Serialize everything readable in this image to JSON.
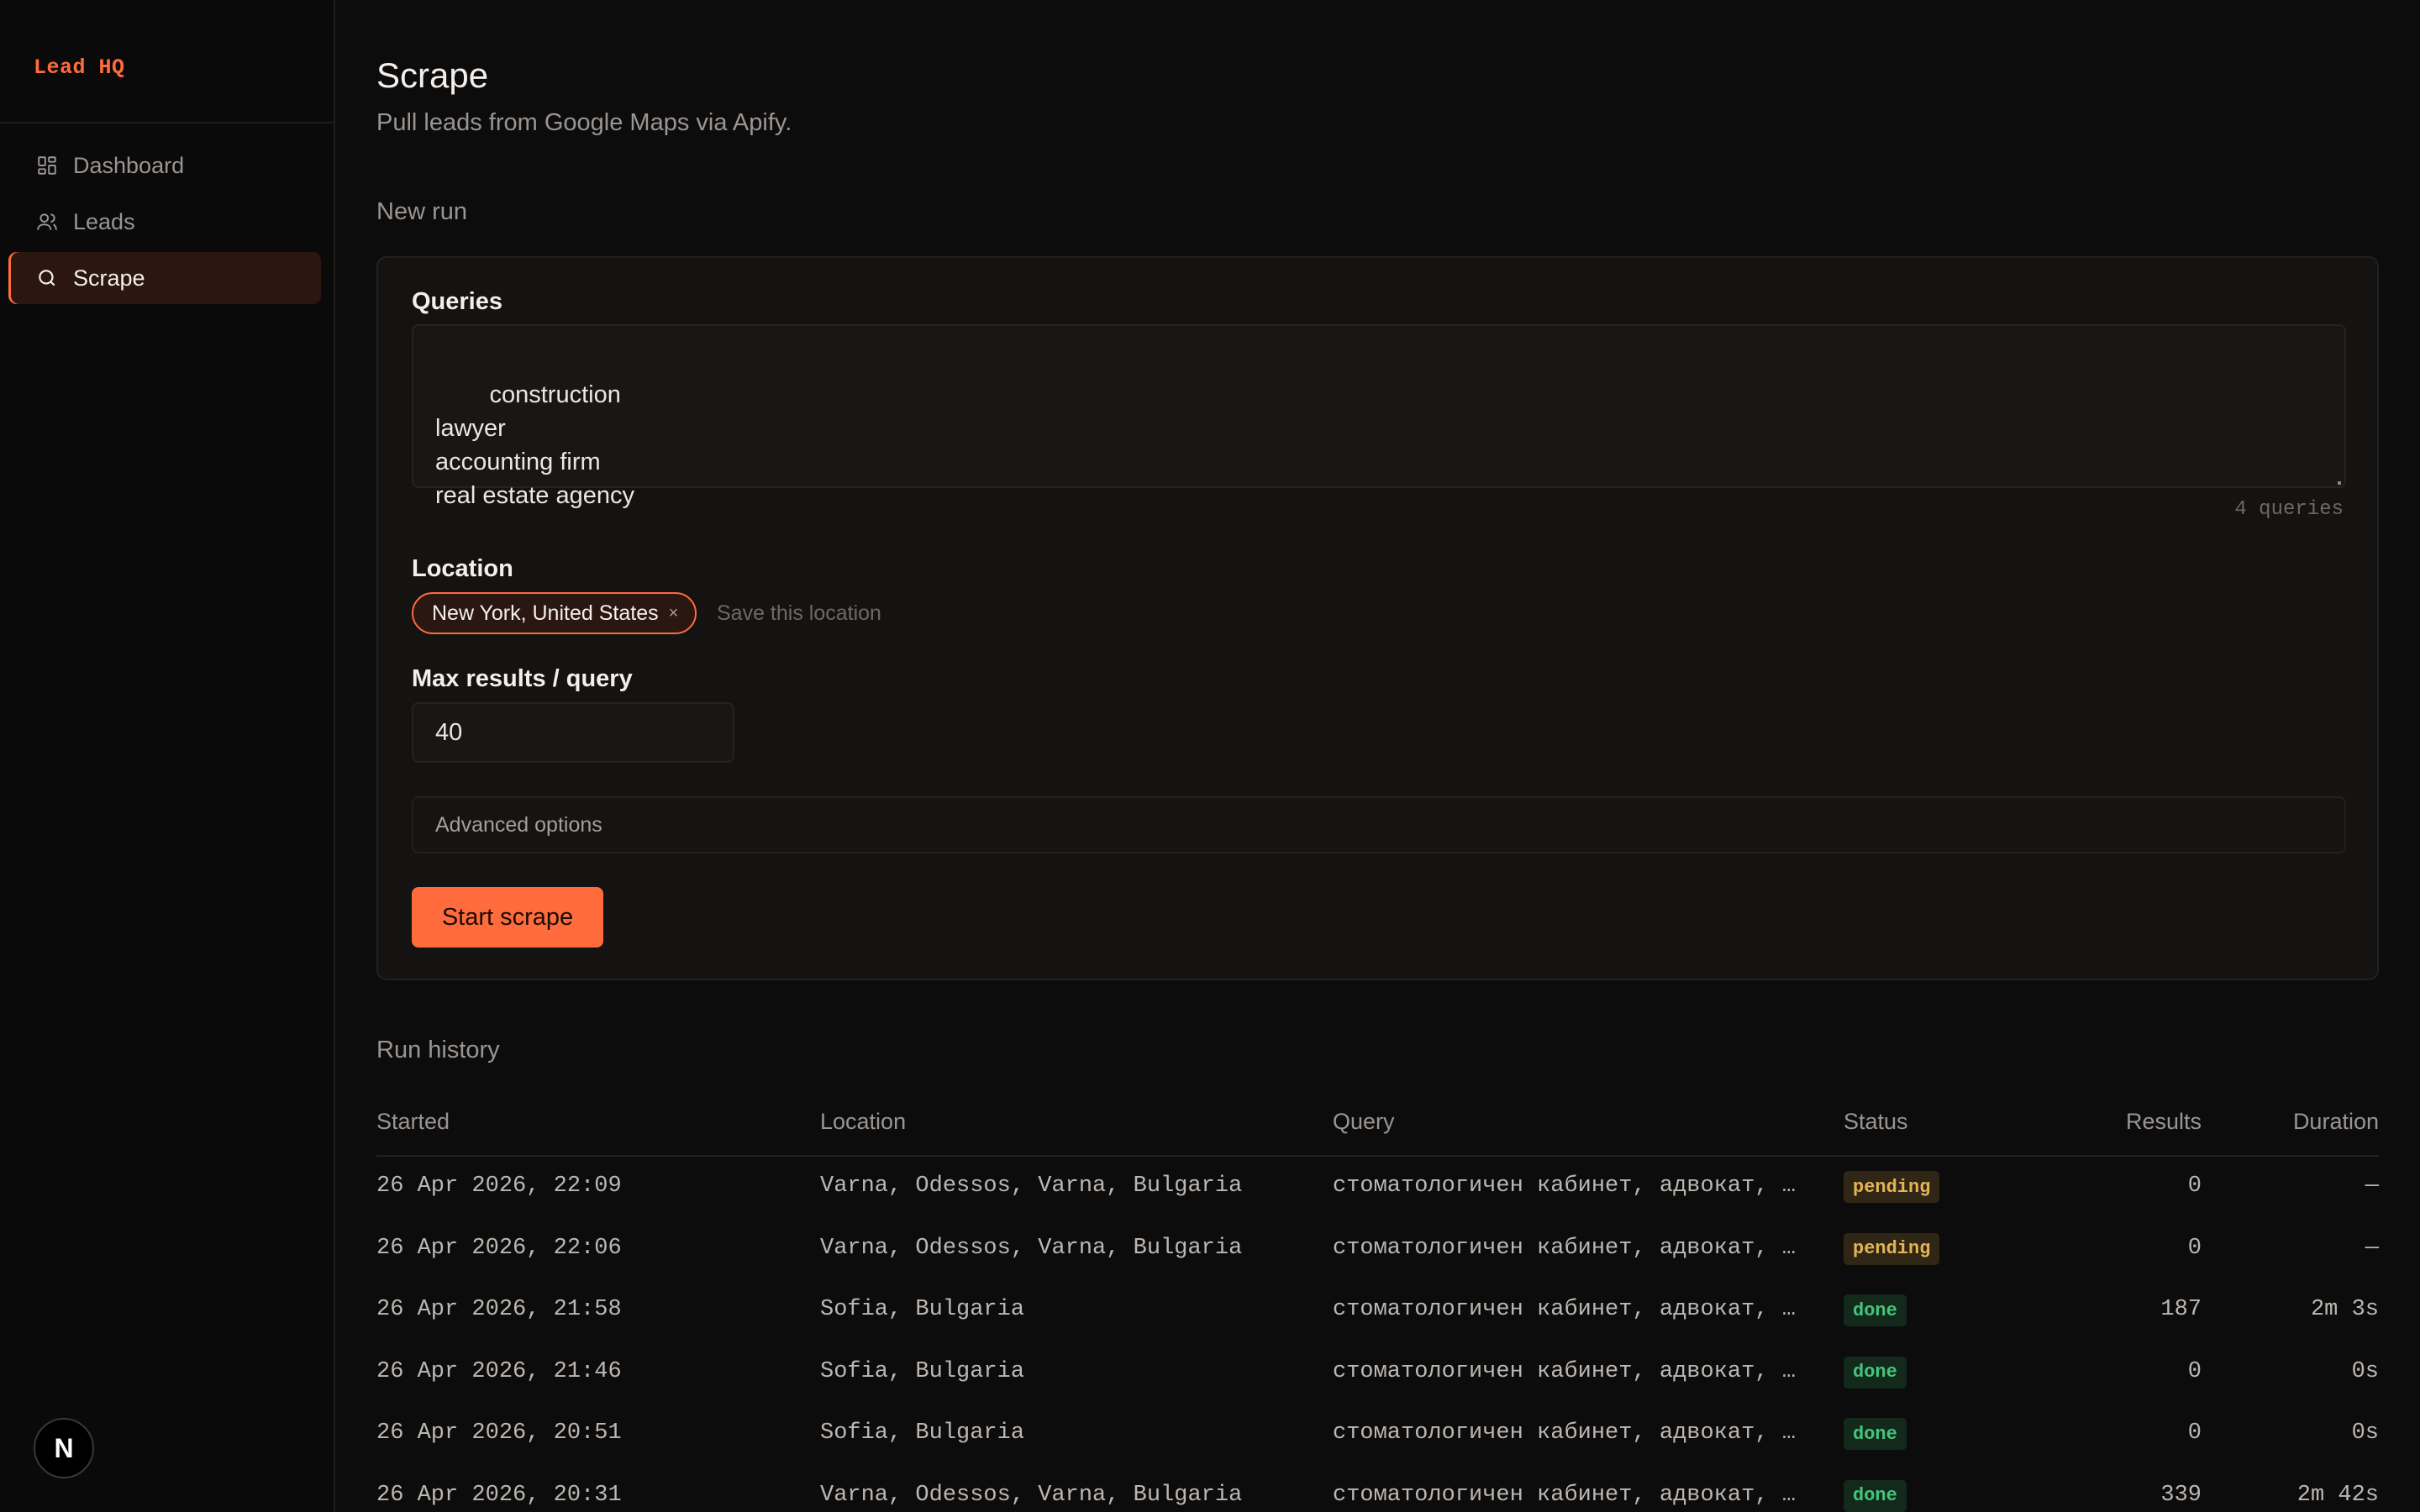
{
  "app": {
    "brand": "Lead HQ"
  },
  "sidebar": {
    "items": [
      {
        "label": "Dashboard",
        "icon": "dashboard-icon",
        "active": false
      },
      {
        "label": "Leads",
        "icon": "users-icon",
        "active": false
      },
      {
        "label": "Scrape",
        "icon": "search-icon",
        "active": true
      }
    ],
    "badge": "N"
  },
  "page": {
    "title": "Scrape",
    "subtitle": "Pull leads from Google Maps via Apify."
  },
  "new_run": {
    "section_label": "New run",
    "queries_label": "Queries",
    "queries_value": "construction\nlawyer\naccounting firm\nreal estate agency",
    "query_count": "4 queries",
    "location_label": "Location",
    "location_chip": "New York, United States",
    "chip_remove": "×",
    "save_location": "Save this location",
    "max_results_label": "Max results / query",
    "max_results_value": "40",
    "advanced_label": "Advanced options",
    "start_button": "Start scrape"
  },
  "run_history": {
    "section_label": "Run history",
    "columns": [
      "Started",
      "Location",
      "Query",
      "Status",
      "Results",
      "Duration"
    ],
    "rows": [
      {
        "started": "26 Apr 2026, 22:09",
        "location": "Varna, Odessos, Varna, Bulgaria",
        "query": "стоматологичен кабинет, адвокат, сч…",
        "status": "pending",
        "results": "0",
        "duration": "—"
      },
      {
        "started": "26 Apr 2026, 22:06",
        "location": "Varna, Odessos, Varna, Bulgaria",
        "query": "стоматологичен кабинет, адвокат, сч…",
        "status": "pending",
        "results": "0",
        "duration": "—"
      },
      {
        "started": "26 Apr 2026, 21:58",
        "location": "Sofia, Bulgaria",
        "query": "стоматологичен кабинет, адвокат, сч…",
        "status": "done",
        "results": "187",
        "duration": "2m 3s"
      },
      {
        "started": "26 Apr 2026, 21:46",
        "location": "Sofia, Bulgaria",
        "query": "стоматологичен кабинет, адвокат, сч…",
        "status": "done",
        "results": "0",
        "duration": "0s"
      },
      {
        "started": "26 Apr 2026, 20:51",
        "location": "Sofia, Bulgaria",
        "query": "стоматологичен кабинет, адвокат, сч…",
        "status": "done",
        "results": "0",
        "duration": "0s"
      },
      {
        "started": "26 Apr 2026, 20:31",
        "location": "Varna, Odessos, Varna, Bulgaria",
        "query": "стоматологичен кабинет, адвокат, сч…",
        "status": "done",
        "results": "339",
        "duration": "2m 42s"
      }
    ]
  },
  "colors": {
    "accent": "#ff6b3d",
    "background": "#0d0c0c",
    "pending": "#e4b455",
    "done": "#45c57a"
  }
}
